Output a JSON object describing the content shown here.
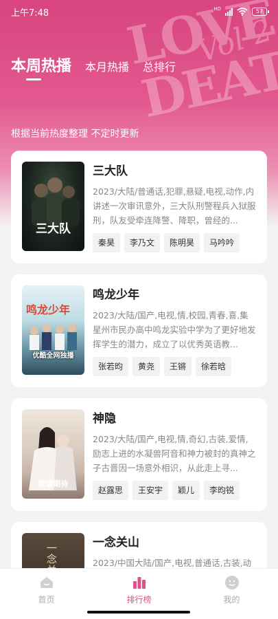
{
  "status_bar": {
    "time": "上午7:48",
    "signal_label": "HD",
    "battery": "57"
  },
  "hero_art": {
    "line1": "LOVE",
    "line2": "DEATH",
    "vol": "Vol 2"
  },
  "tabs": [
    {
      "label": "本周热播",
      "active": true
    },
    {
      "label": "本月热播",
      "active": false
    },
    {
      "label": "总排行",
      "active": false
    }
  ],
  "subtitle": "根据当前热度整理 不定时更新",
  "items": [
    {
      "title": "三大队",
      "meta": "2023/大陆/普通话,犯罪,悬疑,电视,动作,内",
      "desc": "讲述一次审讯意外，三大队刑警程兵入狱服刑，队友受牵连降警、降职，曾经的...",
      "cast": [
        "秦昊",
        "李乃文",
        "陈明昊",
        "马吟吟"
      ],
      "poster_caption": "三大队"
    },
    {
      "title": "鸣龙少年",
      "meta": "2023/大陆/国产,电视,情,校园,青春,喜,集",
      "desc": "星州市民办高中鸣龙实验中学为了更好地发挥学生的潜力，成立了以优秀英语教...",
      "cast": [
        "张若昀",
        "黄尧",
        "王锵",
        "徐若晗"
      ],
      "poster_caption": "优酷全网独播",
      "poster_title": "鸣龙少年"
    },
    {
      "title": "神隐",
      "meta": "2023/大陆/国产,电视,情,奇幻,古装,爱情,",
      "desc": "励志上进的水凝兽阿音和神力被封的真神之子古晋因一场意外相识，从此走上寻...",
      "cast": [
        "赵露思",
        "王安宇",
        "颖儿",
        "李昀锐"
      ],
      "poster_caption": "敬请期待"
    },
    {
      "title": "一念关山",
      "meta": "2023/中国大陆/国产,电视,普通话,古装,动",
      "poster_title": "一念关山"
    }
  ],
  "nav": [
    {
      "label": "首页",
      "icon": "home-icon"
    },
    {
      "label": "排行榜",
      "icon": "ranking-icon",
      "active": true
    },
    {
      "label": "我的",
      "icon": "profile-icon"
    }
  ]
}
